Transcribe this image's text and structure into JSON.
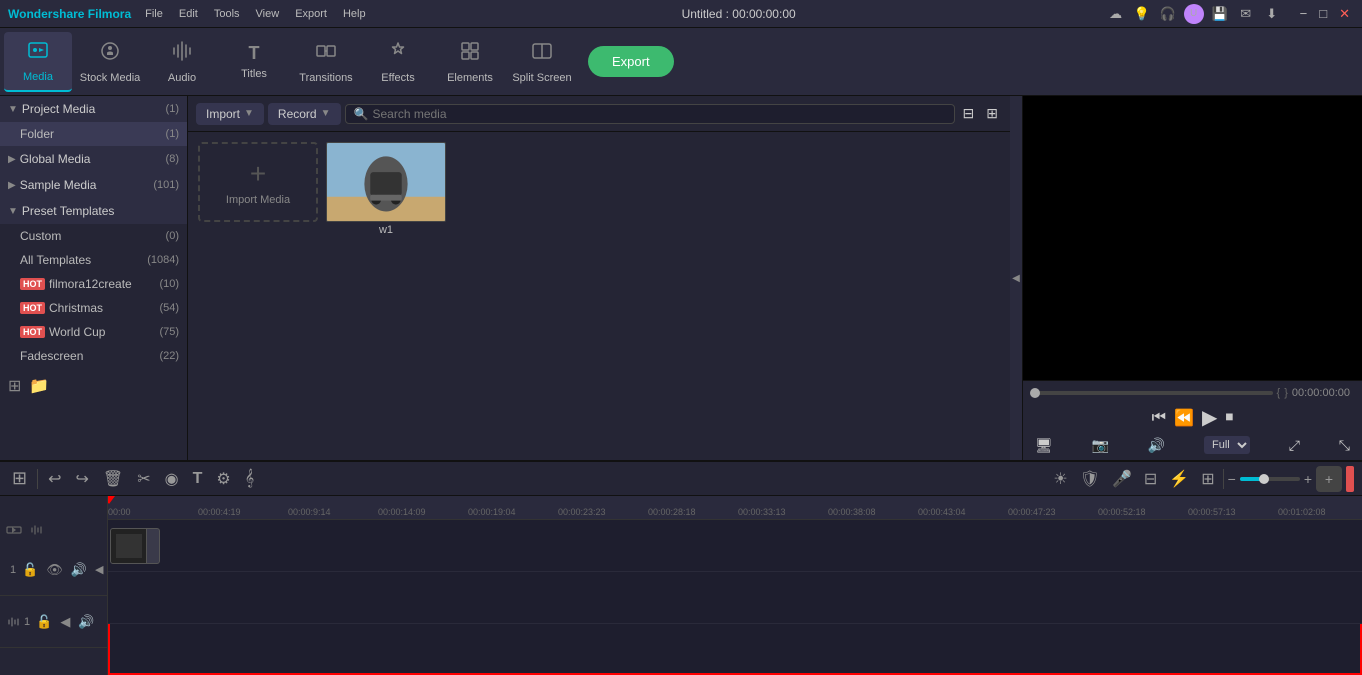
{
  "app": {
    "title": "Wondershare Filmora",
    "window_title": "Untitled : 00:00:00:00"
  },
  "titlebar": {
    "menu_items": [
      "File",
      "Edit",
      "Tools",
      "View",
      "Export",
      "Help"
    ],
    "icons": [
      "cloud-icon",
      "sun-icon",
      "headset-icon",
      "user-icon",
      "save-icon",
      "email-icon",
      "download-icon"
    ]
  },
  "toolbar": {
    "items": [
      {
        "id": "media",
        "label": "Media",
        "icon": "🎬",
        "active": true
      },
      {
        "id": "stock",
        "label": "Stock Media",
        "icon": "📷"
      },
      {
        "id": "audio",
        "label": "Audio",
        "icon": "🎵"
      },
      {
        "id": "titles",
        "label": "Titles",
        "icon": "T"
      },
      {
        "id": "transitions",
        "label": "Transitions",
        "icon": "⬡"
      },
      {
        "id": "effects",
        "label": "Effects",
        "icon": "✨"
      },
      {
        "id": "elements",
        "label": "Elements",
        "icon": "◈"
      },
      {
        "id": "splitscreen",
        "label": "Split Screen",
        "icon": "⊞"
      }
    ],
    "export_label": "Export"
  },
  "sidebar": {
    "sections": [
      {
        "id": "project-media",
        "title": "Project Media",
        "count": "(1)",
        "expanded": true,
        "items": [
          {
            "id": "folder",
            "label": "Folder",
            "count": "(1)",
            "active": true
          }
        ]
      },
      {
        "id": "global-media",
        "title": "Global Media",
        "count": "(8)",
        "expanded": false,
        "items": []
      },
      {
        "id": "sample-media",
        "title": "Sample Media",
        "count": "(101)",
        "expanded": false,
        "items": []
      },
      {
        "id": "preset-templates",
        "title": "Preset Templates",
        "count": "",
        "expanded": true,
        "items": [
          {
            "id": "custom",
            "label": "Custom",
            "count": "(0)",
            "hot": false
          },
          {
            "id": "all-templates",
            "label": "All Templates",
            "count": "(1084)",
            "hot": false
          },
          {
            "id": "filmora12create",
            "label": "filmora12create",
            "count": "(10)",
            "hot": true
          },
          {
            "id": "christmas",
            "label": "Christmas",
            "count": "(54)",
            "hot": true
          },
          {
            "id": "world-cup",
            "label": "World Cup",
            "count": "(75)",
            "hot": true
          },
          {
            "id": "fadescreen",
            "label": "Fadescreen",
            "count": "(22)",
            "hot": false
          }
        ]
      }
    ]
  },
  "media_toolbar": {
    "import_label": "Import",
    "record_label": "Record",
    "search_placeholder": "Search media"
  },
  "media_content": {
    "import_label": "Import Media",
    "files": [
      {
        "id": "w1",
        "name": "w1",
        "has_thumb": true
      }
    ]
  },
  "preview": {
    "time_current": "00:00:00:00",
    "time_bracket_start": "{",
    "time_bracket_end": "}",
    "quality": "Full",
    "progress": 0
  },
  "timeline": {
    "toolbar_tools": [
      "undo",
      "redo",
      "delete",
      "cut",
      "magnetic",
      "text",
      "adjust",
      "beats"
    ],
    "toolbar_right": [
      "stabilize",
      "smart-cutout",
      "mic",
      "multicam",
      "instant",
      "mosaic",
      "zoom-out",
      "zoom-in",
      "add-clip"
    ],
    "ruler_marks": [
      "00:00",
      "00:00:4:19",
      "00:00:9:14",
      "00:00:14:09",
      "00:00:19:04",
      "00:00:23:23",
      "00:00:28:18",
      "00:00:33:13",
      "00:00:38:08",
      "00:00:43:04",
      "00:00:47:23",
      "00:00:52:18",
      "00:00:57:13",
      "00:01:02:08"
    ],
    "tracks": [
      {
        "id": "video1",
        "type": "video",
        "num": "1",
        "has_clip": true
      },
      {
        "id": "audio1",
        "type": "audio",
        "num": "1",
        "has_clip": false
      }
    ]
  }
}
